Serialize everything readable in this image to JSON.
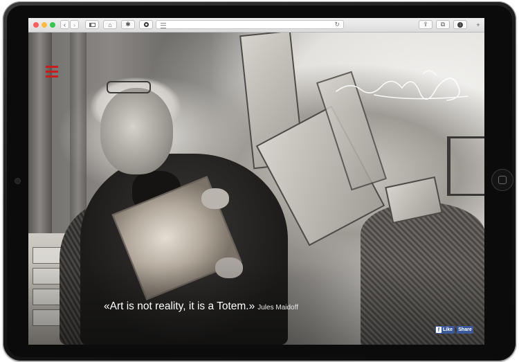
{
  "browser": {
    "traffic_lights": {
      "close": "#fc605c",
      "minimize": "#fdbc40",
      "zoom": "#34c84a"
    },
    "toolbar_icons": [
      "back-icon",
      "forward-icon",
      "sidebar-icon",
      "home-icon",
      "extension-icon",
      "privacy-icon",
      "reader-icon",
      "reload-icon",
      "share-icon",
      "tabs-icon",
      "download-icon",
      "new-tab-icon"
    ],
    "address": ""
  },
  "page": {
    "menu_icon_color": "#c81d1d",
    "signature_text": "maidoff",
    "quote": "«Art is not reality, it is a Totem.»",
    "author": "Jules Maidoff",
    "facebook": {
      "like_label": "Like",
      "share_label": "Share",
      "brand_color": "#3b5998"
    }
  }
}
